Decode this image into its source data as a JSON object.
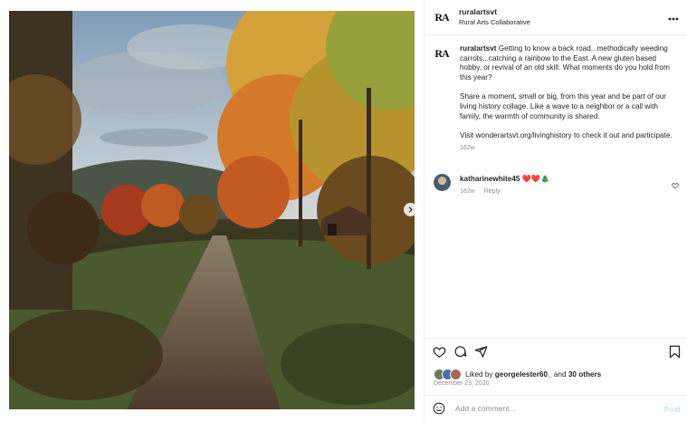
{
  "post": {
    "author_username": "ruralartsvt",
    "author_subtitle": "Rural Arts Collaborative",
    "author_avatar_text": "RA",
    "more_icon": "more-horizontal-icon",
    "caption_paragraph_1": "Getting to know a back road...methodically weeding carrots...catching a rainbow to the East. A new gluten based hobby, or revival of an old skill. What moments do you hold from this year?",
    "caption_paragraph_2": "Share a moment, small or big, from this year and be part of our living history collage. Like a wave to a neighbor or a call with family, the warmth of community is shared.",
    "caption_paragraph_3": "Visit wonderartsvt.org/livinghistory to check it out and participate.",
    "caption_age": "162w",
    "image_alt": "Dirt road through autumn trees at sunset"
  },
  "comments": [
    {
      "username": "katharinewhite45",
      "emoji": "❤️❤️🎄",
      "age": "162w",
      "reply_label": "Reply"
    }
  ],
  "actions": {
    "icons": [
      "heart-icon",
      "comment-icon",
      "share-icon",
      "bookmark-icon"
    ]
  },
  "likes": {
    "prefix": "Liked by",
    "user": "georgelester60_",
    "conjunction": "and",
    "others": "30 others"
  },
  "date": "December 23, 2020",
  "composer": {
    "placeholder": "Add a comment...",
    "post_label": "Post",
    "emoji_icon": "smiley-icon"
  },
  "colors": {
    "text": "#262626",
    "muted": "#8e8e8e",
    "border": "#efefef",
    "post_disabled": "#c7dffa",
    "heart_red": "#ed4956"
  }
}
